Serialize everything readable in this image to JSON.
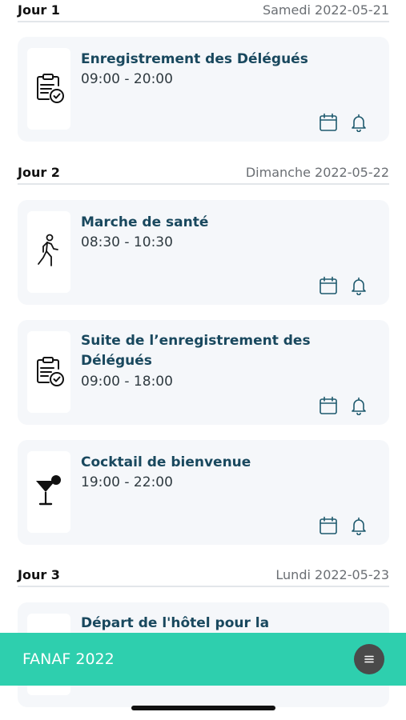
{
  "schedule": {
    "days": [
      {
        "label": "Jour 1",
        "date": "Samedi 2022-05-21",
        "events": [
          {
            "title": "Enregistrement des Délégués",
            "time": "09:00 - 20:00",
            "icon": "clipboard-check-icon"
          }
        ]
      },
      {
        "label": "Jour 2",
        "date": "Dimanche 2022-05-22",
        "events": [
          {
            "title": "Marche de santé",
            "time": "08:30 - 10:30",
            "icon": "walking-person-icon"
          },
          {
            "title": "Suite de l’enregistrement des Délégués",
            "time": "09:00 - 18:00",
            "icon": "clipboard-check-icon"
          },
          {
            "title": "Cocktail de bienvenue",
            "time": "19:00 - 22:00",
            "icon": "cocktail-glass-icon"
          }
        ]
      },
      {
        "label": "Jour 3",
        "date": "Lundi 2022-05-23",
        "events": [
          {
            "title": "Départ de l'hôtel pour la Grande",
            "time": "",
            "icon": ""
          }
        ]
      }
    ]
  },
  "footer": {
    "title": "FANAF 2022",
    "menu_icon": "menu-icon"
  },
  "colors": {
    "accent": "#2ecfae",
    "title": "#19485e",
    "card_bg": "#f5f7fa",
    "action_icon": "#1f5a6e"
  }
}
